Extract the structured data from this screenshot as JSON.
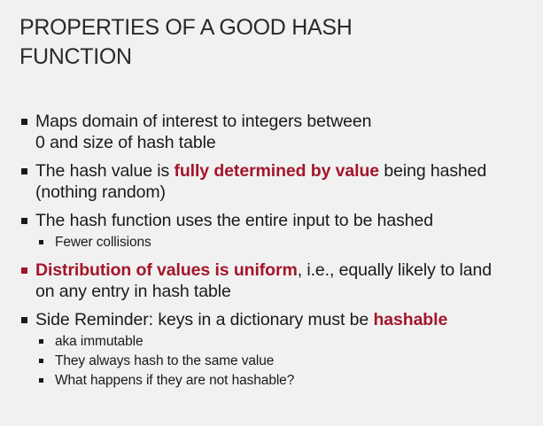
{
  "slide": {
    "title_line1": "PROPERTIES OF A GOOD HASH",
    "title_line2": "FUNCTION",
    "bullets": [
      {
        "line1": "Maps domain of interest to integers between",
        "line2": "0 and size of hash table"
      },
      {
        "pre": "The hash value is ",
        "highlight": "fully determined by value",
        "post": " being hashed",
        "line2": "(nothing random)"
      },
      {
        "line1": "The hash function uses the entire input to be hashed",
        "sub": [
          "Fewer collisions"
        ]
      },
      {
        "highlight": "Distribution of values is uniform",
        "post": ", i.e., equally likely to land",
        "line2": "on any entry in hash table"
      },
      {
        "pre": "Side Reminder: keys in a dictionary must be ",
        "highlight": "hashable",
        "sub": [
          "aka immutable",
          "They always hash to the same value",
          "What happens if they are not hashable?"
        ]
      }
    ]
  },
  "colors": {
    "background": "#f1f1f1",
    "text": "#1a1a1a",
    "highlight": "#a3162a"
  }
}
